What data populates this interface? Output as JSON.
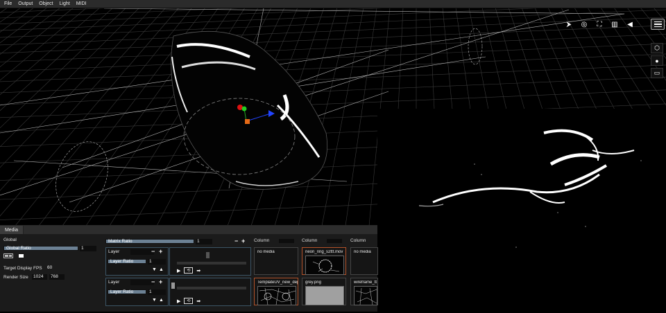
{
  "menu": [
    "File",
    "Output",
    "Object",
    "Light",
    "MIDI"
  ],
  "view_toolbar": {
    "icons": [
      "select-icon",
      "orbit-icon",
      "fit-frame-icon",
      "camera-grid-icon",
      "play-triangle-icon"
    ],
    "glyphs": [
      "⮞",
      "◎",
      "⛶",
      "▥",
      "◀"
    ]
  },
  "side_tools": {
    "icons": [
      "cube-icon",
      "light-bulb-icon",
      "monitor-icon"
    ],
    "glyphs": [
      "⬡",
      "●",
      "▭"
    ]
  },
  "panel": {
    "tab": "Media",
    "global_label": "Global",
    "global_ratio_label": "Global Ratio",
    "global_ratio_value": "1",
    "global_ratio_fill": 1.0,
    "fps_label": "Target Display FPS",
    "fps_value": "60",
    "render_label": "Render Size",
    "render_w": "1024",
    "render_h": "768"
  },
  "matrix": {
    "label": "Matrix Ratio",
    "value": "1",
    "fill": 1.0,
    "columns": [
      "Column",
      "Column",
      "Column"
    ]
  },
  "layers": [
    {
      "name": "Layer",
      "ratio_label": "Layer Ratio",
      "ratio_value": "1",
      "clips": [
        {
          "title": "no media",
          "thumb": "none",
          "selected": false
        },
        {
          "title": "neon_ring_s2ttt.mov",
          "thumb": "neon",
          "selected": true
        },
        {
          "title": "no media",
          "thumb": "none",
          "selected": false
        }
      ]
    },
    {
      "name": "Layer",
      "ratio_label": "Layer Ratio",
      "ratio_value": "1",
      "clips": [
        {
          "title": "TemplateUV_new_dep",
          "thumb": "uv",
          "selected": true
        },
        {
          "title": "grey.png",
          "thumb": "grey",
          "selected": false
        },
        {
          "title": "wireframe_tt",
          "thumb": "wire",
          "selected": false
        }
      ]
    }
  ],
  "colors": {
    "accent": "#6c8194",
    "selected_border": "#b5532a",
    "layer_border": "#3c5566"
  }
}
